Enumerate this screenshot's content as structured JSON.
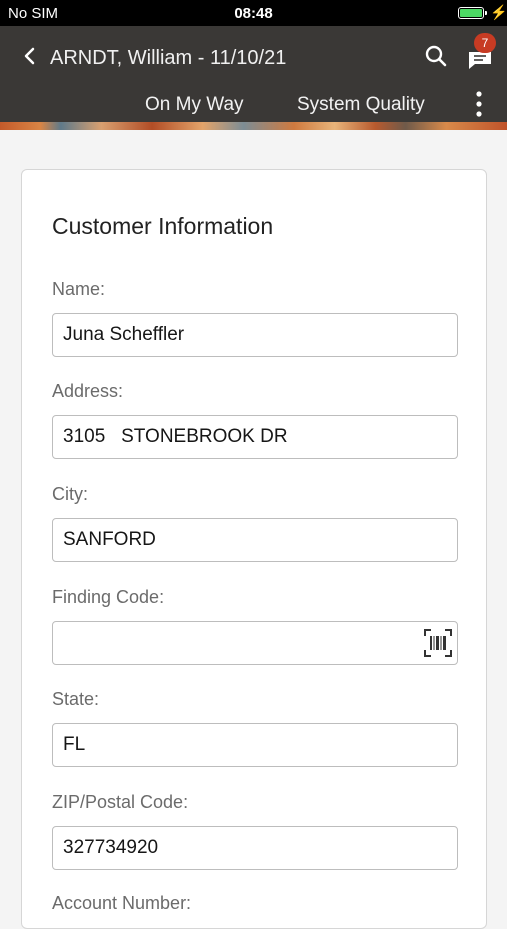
{
  "status_bar": {
    "carrier": "No SIM",
    "time": "08:48"
  },
  "header": {
    "title": "ARNDT, William - 11/10/21",
    "notification_count": "7",
    "tabs": [
      "On My Way",
      "System Quality"
    ]
  },
  "form": {
    "section_title": "Customer Information",
    "fields": [
      {
        "label": "Name:",
        "value": "Juna Scheffler"
      },
      {
        "label": "Address:",
        "value": "3105   STONEBROOK DR"
      },
      {
        "label": "City:",
        "value": "SANFORD"
      },
      {
        "label": "Finding Code:",
        "value": ""
      },
      {
        "label": "State:",
        "value": "FL"
      },
      {
        "label": "ZIP/Postal Code:",
        "value": "327734920"
      },
      {
        "label": "Account Number:",
        "value": ""
      }
    ]
  },
  "icons": {
    "back": "chevron-left-icon",
    "search": "search-icon",
    "messages": "chat-icon",
    "more": "more-vertical-icon",
    "barcode": "barcode-scan-icon"
  },
  "colors": {
    "header_bg": "#3a3836",
    "badge": "#c73b23",
    "battery": "#4cd964"
  }
}
